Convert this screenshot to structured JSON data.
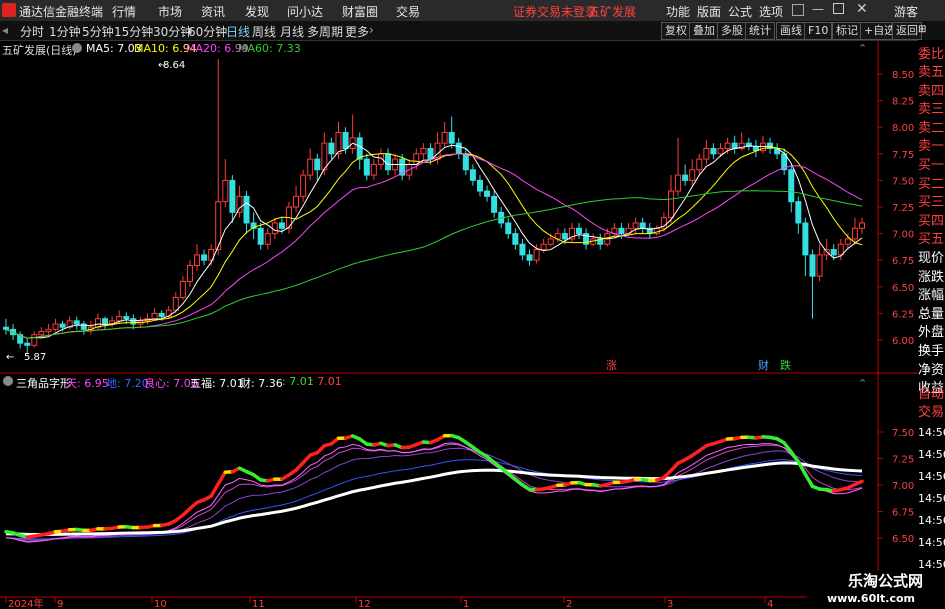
{
  "app": {
    "name": "通达信金融终端",
    "menu": [
      "行情",
      "市场",
      "资讯",
      "发现",
      "问小达",
      "财富圈",
      "交易"
    ],
    "warning": [
      "证券交易未登录",
      "五矿发展"
    ],
    "right_menu": [
      "功能",
      "版面",
      "公式",
      "选项"
    ],
    "guest": "游客"
  },
  "toolbar": {
    "timeframes": [
      "分时",
      "1分钟",
      "5分钟",
      "15分钟",
      "30分钟",
      "60分钟",
      "日线",
      "周线",
      "月线",
      "多周期",
      "更多"
    ],
    "active": "日线",
    "buttons": [
      "复权",
      "叠加",
      "多股",
      "统计",
      "画线",
      "F10",
      "标记",
      "+自选",
      "返回"
    ]
  },
  "main_chart": {
    "title": "五矿发展(日线)",
    "ma": [
      {
        "label": "MA5: 7.03",
        "color": "#ffffff"
      },
      {
        "label": "MA10: 6.94",
        "color": "#ffff00"
      },
      {
        "label": "MA20: 6.99",
        "color": "#ff44ff"
      },
      {
        "label": "MA60: 7.33",
        "color": "#33cc33"
      }
    ],
    "yticks": [
      "8.50",
      "8.25",
      "8.00",
      "7.75",
      "7.50",
      "7.25",
      "7.00",
      "6.75",
      "6.50",
      "6.25",
      "6.00"
    ],
    "high_label": "8.64",
    "low_label": "5.87",
    "markers": [
      {
        "text": "涨",
        "color": "#ff4040"
      },
      {
        "text": "财",
        "color": "#4aa3ff"
      },
      {
        "text": "跌",
        "color": "#33dd33"
      }
    ]
  },
  "indicator_chart": {
    "title": "三角品字形",
    "legend": [
      {
        "label": "天: 6.95",
        "color": "#ff44ff"
      },
      {
        "label": "地: 7.20",
        "color": "#3366ff"
      },
      {
        "label": "良心: 7.00",
        "color": "#ff44ff"
      },
      {
        "label": "五福: 7.01",
        "color": "#ffffff"
      },
      {
        "label": "财: 7.36",
        "color": "#ffffff"
      },
      {
        "label": ": 7.01",
        "color": "#33dd33"
      },
      {
        "label": ": 7.01",
        "color": "#ff4040"
      }
    ],
    "yticks": [
      "7.50",
      "7.25",
      "7.00",
      "6.75",
      "6.50"
    ]
  },
  "xaxis": {
    "labels": [
      "2024年",
      "9",
      "10",
      "11",
      "12",
      "1",
      "2",
      "3",
      "4"
    ]
  },
  "sidepanel": {
    "top_label": "委比",
    "items": [
      {
        "text": "卖五",
        "color": "red"
      },
      {
        "text": "卖四",
        "color": "red"
      },
      {
        "text": "卖三",
        "color": "red"
      },
      {
        "text": "卖二",
        "color": "red"
      },
      {
        "text": "卖一",
        "color": "red"
      },
      {
        "text": "买一",
        "color": "red"
      },
      {
        "text": "买二",
        "color": "red"
      },
      {
        "text": "买三",
        "color": "red"
      },
      {
        "text": "买四",
        "color": "red"
      },
      {
        "text": "买五",
        "color": "red"
      },
      {
        "text": "现价",
        "color": "white"
      },
      {
        "text": "涨跌",
        "color": "white"
      },
      {
        "text": "涨幅",
        "color": "white"
      },
      {
        "text": "总量",
        "color": "white"
      },
      {
        "text": "外盘",
        "color": "white"
      },
      {
        "text": "换手",
        "color": "white"
      },
      {
        "text": "净资",
        "color": "white"
      },
      {
        "text": "收益",
        "color": "white"
      }
    ],
    "trade_labels": [
      "自动",
      "交易"
    ],
    "times": [
      "14:56",
      "14:56",
      "14:56",
      "14:56",
      "14:56",
      "14:56",
      "14:56",
      "14:56"
    ]
  },
  "watermark": {
    "line1": "乐淘公式网",
    "line2": "www.60lt.com"
  },
  "candles": [
    [
      6.12,
      6.1,
      6.2,
      6.05
    ],
    [
      6.1,
      6.05,
      6.15,
      6.0
    ],
    [
      6.05,
      5.97,
      6.08,
      5.92
    ],
    [
      5.97,
      5.95,
      6.02,
      5.87
    ],
    [
      5.95,
      6.05,
      6.08,
      5.93
    ],
    [
      6.05,
      6.08,
      6.12,
      6.02
    ],
    [
      6.08,
      6.1,
      6.15,
      6.05
    ],
    [
      6.1,
      6.15,
      6.2,
      6.08
    ],
    [
      6.15,
      6.12,
      6.18,
      6.08
    ],
    [
      6.12,
      6.18,
      6.22,
      6.1
    ],
    [
      6.18,
      6.15,
      6.22,
      6.1
    ],
    [
      6.15,
      6.1,
      6.18,
      6.05
    ],
    [
      6.1,
      6.12,
      6.18,
      6.05
    ],
    [
      6.12,
      6.2,
      6.25,
      6.1
    ],
    [
      6.2,
      6.15,
      6.22,
      6.1
    ],
    [
      6.15,
      6.18,
      6.22,
      6.12
    ],
    [
      6.18,
      6.22,
      6.28,
      6.15
    ],
    [
      6.22,
      6.2,
      6.26,
      6.15
    ],
    [
      6.2,
      6.15,
      6.24,
      6.1
    ],
    [
      6.15,
      6.18,
      6.22,
      6.12
    ],
    [
      6.18,
      6.2,
      6.25,
      6.15
    ],
    [
      6.2,
      6.25,
      6.3,
      6.18
    ],
    [
      6.25,
      6.22,
      6.28,
      6.18
    ],
    [
      6.22,
      6.28,
      6.32,
      6.2
    ],
    [
      6.28,
      6.4,
      6.45,
      6.25
    ],
    [
      6.4,
      6.55,
      6.6,
      6.38
    ],
    [
      6.55,
      6.7,
      6.75,
      6.5
    ],
    [
      6.7,
      6.8,
      6.9,
      6.65
    ],
    [
      6.8,
      6.75,
      6.85,
      6.7
    ],
    [
      6.75,
      6.85,
      6.9,
      6.7
    ],
    [
      6.85,
      7.3,
      8.64,
      6.8
    ],
    [
      7.3,
      7.5,
      7.7,
      7.25
    ],
    [
      7.5,
      7.2,
      7.55,
      7.1
    ],
    [
      7.2,
      7.35,
      7.45,
      7.15
    ],
    [
      7.35,
      7.1,
      7.4,
      7.0
    ],
    [
      7.1,
      7.05,
      7.2,
      6.95
    ],
    [
      7.05,
      6.9,
      7.1,
      6.85
    ],
    [
      6.9,
      7.0,
      7.05,
      6.85
    ],
    [
      7.0,
      7.1,
      7.15,
      6.95
    ],
    [
      7.1,
      7.05,
      7.15,
      7.0
    ],
    [
      7.05,
      7.25,
      7.3,
      7.0
    ],
    [
      7.25,
      7.35,
      7.45,
      7.2
    ],
    [
      7.35,
      7.55,
      7.6,
      7.3
    ],
    [
      7.55,
      7.7,
      7.8,
      7.5
    ],
    [
      7.7,
      7.6,
      7.75,
      7.5
    ],
    [
      7.6,
      7.85,
      7.95,
      7.55
    ],
    [
      7.85,
      7.75,
      7.9,
      7.7
    ],
    [
      7.75,
      7.95,
      8.05,
      7.7
    ],
    [
      7.95,
      7.8,
      8.0,
      7.75
    ],
    [
      7.8,
      7.9,
      8.12,
      7.75
    ],
    [
      7.9,
      7.7,
      7.95,
      7.6
    ],
    [
      7.7,
      7.55,
      7.75,
      7.5
    ],
    [
      7.55,
      7.65,
      7.7,
      7.5
    ],
    [
      7.65,
      7.75,
      7.8,
      7.6
    ],
    [
      7.75,
      7.6,
      7.8,
      7.55
    ],
    [
      7.6,
      7.7,
      7.75,
      7.55
    ],
    [
      7.7,
      7.55,
      7.75,
      7.5
    ],
    [
      7.55,
      7.65,
      7.7,
      7.5
    ],
    [
      7.65,
      7.75,
      7.8,
      7.6
    ],
    [
      7.75,
      7.8,
      7.85,
      7.7
    ],
    [
      7.8,
      7.7,
      7.85,
      7.65
    ],
    [
      7.7,
      7.85,
      7.95,
      7.65
    ],
    [
      7.85,
      7.95,
      8.05,
      7.8
    ],
    [
      7.95,
      7.85,
      8.1,
      7.8
    ],
    [
      7.85,
      7.75,
      7.9,
      7.7
    ],
    [
      7.75,
      7.6,
      7.8,
      7.55
    ],
    [
      7.6,
      7.5,
      7.65,
      7.45
    ],
    [
      7.5,
      7.4,
      7.55,
      7.35
    ],
    [
      7.4,
      7.35,
      7.45,
      7.3
    ],
    [
      7.35,
      7.2,
      7.4,
      7.15
    ],
    [
      7.2,
      7.1,
      7.25,
      7.05
    ],
    [
      7.1,
      7.0,
      7.15,
      6.95
    ],
    [
      7.0,
      6.9,
      7.05,
      6.85
    ],
    [
      6.9,
      6.8,
      6.95,
      6.75
    ],
    [
      6.8,
      6.75,
      6.85,
      6.7
    ],
    [
      6.75,
      6.85,
      6.9,
      6.72
    ],
    [
      6.85,
      6.9,
      6.95,
      6.82
    ],
    [
      6.9,
      6.95,
      7.0,
      6.88
    ],
    [
      6.95,
      7.0,
      7.05,
      6.92
    ],
    [
      7.0,
      6.95,
      7.05,
      6.9
    ],
    [
      6.95,
      7.05,
      7.1,
      6.92
    ],
    [
      7.05,
      7.0,
      7.1,
      6.95
    ],
    [
      7.0,
      6.9,
      7.05,
      6.85
    ],
    [
      6.9,
      6.95,
      7.0,
      6.88
    ],
    [
      6.95,
      6.9,
      7.0,
      6.85
    ],
    [
      6.9,
      7.0,
      7.05,
      6.88
    ],
    [
      7.0,
      7.05,
      7.1,
      6.98
    ],
    [
      7.05,
      7.0,
      7.1,
      6.95
    ],
    [
      7.0,
      7.05,
      7.1,
      6.98
    ],
    [
      7.05,
      7.1,
      7.15,
      7.0
    ],
    [
      7.1,
      7.05,
      7.15,
      7.0
    ],
    [
      7.05,
      7.0,
      7.1,
      6.95
    ],
    [
      7.0,
      7.05,
      7.08,
      6.98
    ],
    [
      7.05,
      7.15,
      7.2,
      7.02
    ],
    [
      7.15,
      7.4,
      7.55,
      7.1
    ],
    [
      7.4,
      7.55,
      7.9,
      7.35
    ],
    [
      7.55,
      7.5,
      7.65,
      7.45
    ],
    [
      7.5,
      7.6,
      7.7,
      7.45
    ],
    [
      7.6,
      7.7,
      7.75,
      7.55
    ],
    [
      7.7,
      7.8,
      7.88,
      7.65
    ],
    [
      7.8,
      7.75,
      7.85,
      7.7
    ],
    [
      7.75,
      7.8,
      7.85,
      7.72
    ],
    [
      7.8,
      7.85,
      7.9,
      7.75
    ],
    [
      7.85,
      7.8,
      7.92,
      7.75
    ],
    [
      7.8,
      7.85,
      7.95,
      7.78
    ],
    [
      7.85,
      7.82,
      7.9,
      7.78
    ],
    [
      7.82,
      7.78,
      7.88,
      7.72
    ],
    [
      7.78,
      7.85,
      7.92,
      7.75
    ],
    [
      7.85,
      7.8,
      7.9,
      7.75
    ],
    [
      7.8,
      7.75,
      7.85,
      7.7
    ],
    [
      7.75,
      7.6,
      7.8,
      7.55
    ],
    [
      7.6,
      7.3,
      7.65,
      7.2
    ],
    [
      7.3,
      7.1,
      7.35,
      7.0
    ],
    [
      7.1,
      6.8,
      7.15,
      6.6
    ],
    [
      6.8,
      6.6,
      6.85,
      6.2
    ],
    [
      6.6,
      6.8,
      6.9,
      6.55
    ],
    [
      6.8,
      6.85,
      6.95,
      6.75
    ],
    [
      6.85,
      6.8,
      6.9,
      6.75
    ],
    [
      6.8,
      6.9,
      6.95,
      6.75
    ],
    [
      6.9,
      6.95,
      7.0,
      6.85
    ],
    [
      6.95,
      7.05,
      7.15,
      6.9
    ],
    [
      7.05,
      7.1,
      7.15,
      7.0
    ]
  ]
}
